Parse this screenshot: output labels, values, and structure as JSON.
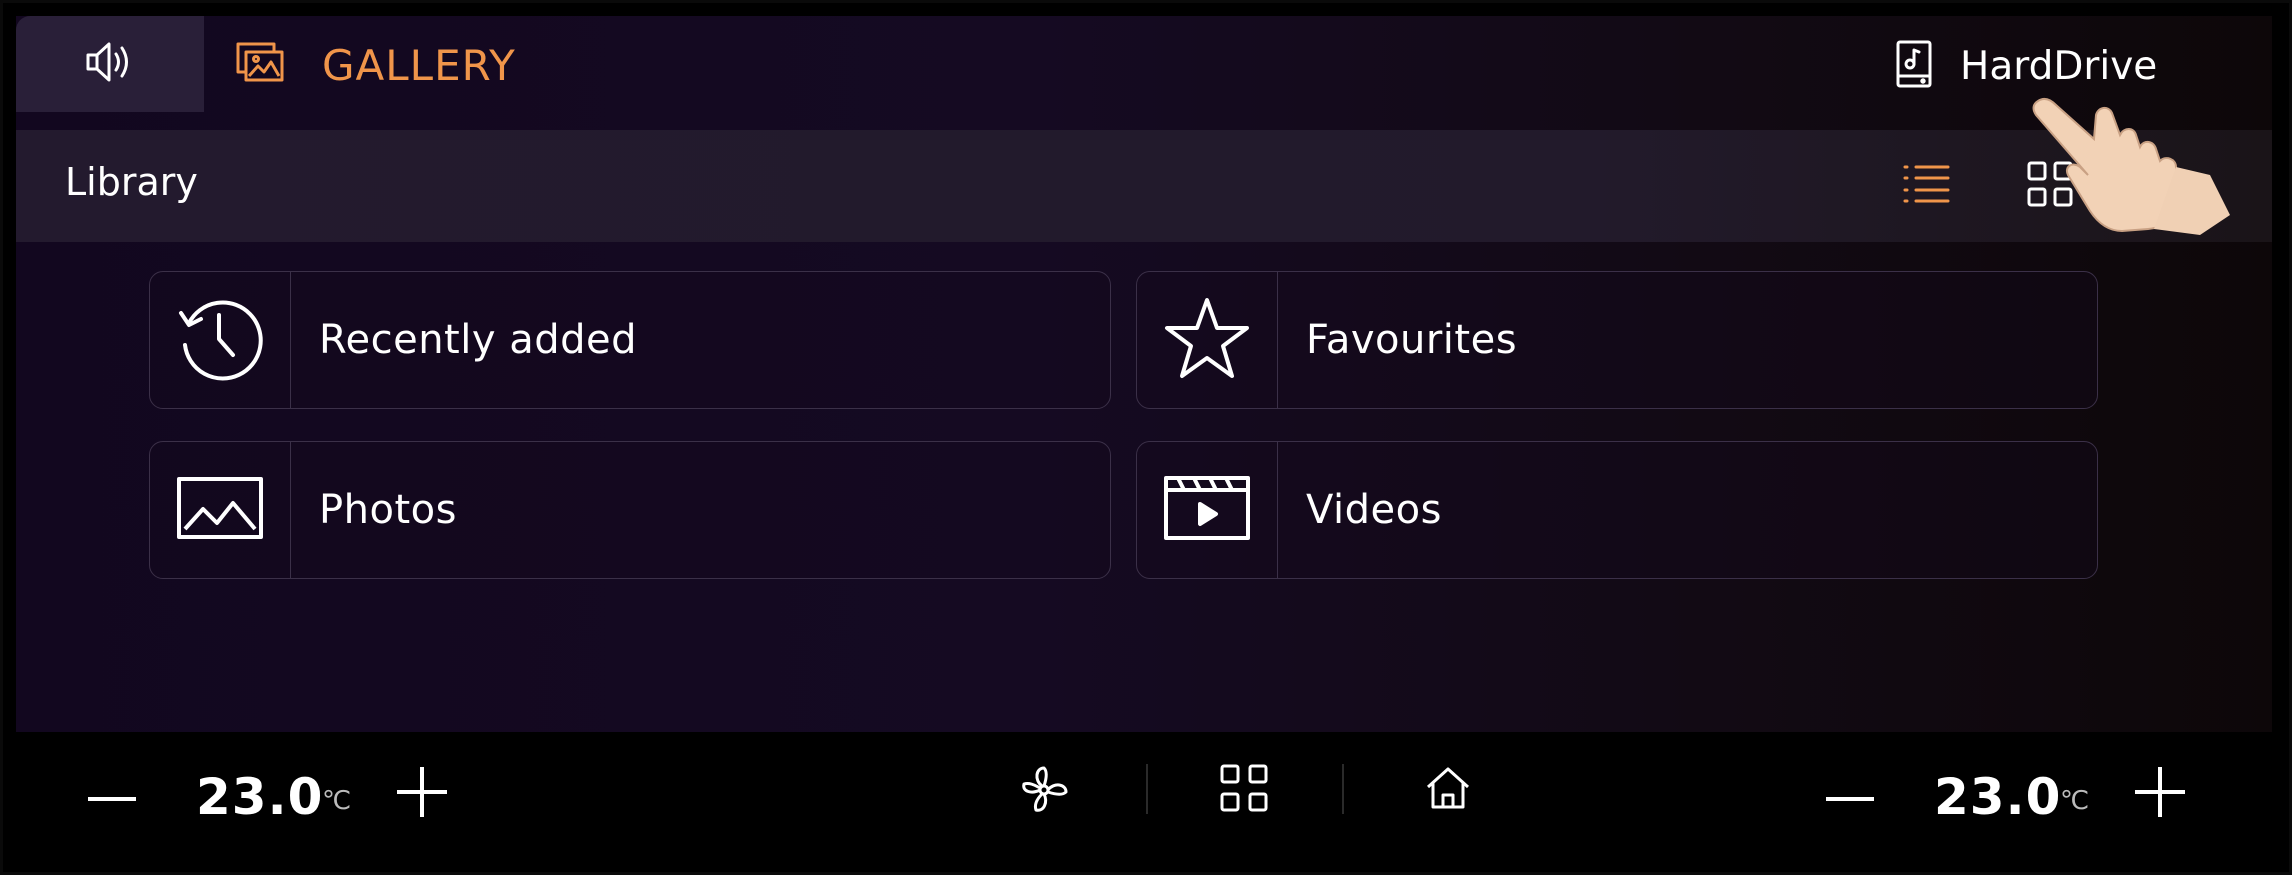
{
  "header": {
    "app_title": "GALLERY",
    "source_label": "HardDrive"
  },
  "library_bar": {
    "title": "Library"
  },
  "tiles": [
    {
      "label": "Recently added",
      "icon": "clock-history-icon"
    },
    {
      "label": "Favourites",
      "icon": "star-icon"
    },
    {
      "label": "Photos",
      "icon": "image-icon"
    },
    {
      "label": "Videos",
      "icon": "video-clapper-icon"
    }
  ],
  "climate": {
    "left_temp": "23.0",
    "right_temp": "23.0",
    "unit": "℃"
  },
  "colors": {
    "accent": "#f0954a",
    "background": "#12071f",
    "sound_button": "#291f38"
  }
}
